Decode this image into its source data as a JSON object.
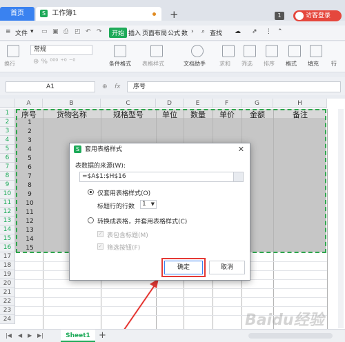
{
  "titlebar": {
    "home_tab": "首页",
    "doc_tab_icon": "S",
    "doc_tab": "工作簿1",
    "new_tab": "+",
    "badge": "1",
    "visitor": "访客登录"
  },
  "menubar": {
    "file": "文件",
    "tabs": [
      "开始",
      "插入",
      "页面布局",
      "公式",
      "数"
    ],
    "search": "查找"
  },
  "ribbon": {
    "format_value": "常规",
    "items": [
      "换行",
      "条件格式",
      "表格样式",
      "文档助手",
      "求和",
      "筛选",
      "排序",
      "格式",
      "填充",
      "行"
    ]
  },
  "formula_bar": {
    "cell_ref": "A1",
    "fx": "fx",
    "content": "序号"
  },
  "grid": {
    "columns": [
      "A",
      "B",
      "C",
      "D",
      "E",
      "F",
      "G",
      "H"
    ],
    "rows": [
      "1",
      "2",
      "3",
      "4",
      "5",
      "6",
      "7",
      "8",
      "9",
      "10",
      "11",
      "12",
      "13",
      "14",
      "15",
      "16",
      "17",
      "18",
      "19",
      "20",
      "21",
      "22",
      "23",
      "24"
    ],
    "headers": [
      "序号",
      "货物名称",
      "规格型号",
      "单位",
      "数量",
      "单价",
      "金额",
      "备注"
    ],
    "numbers": [
      "1",
      "2",
      "3",
      "4",
      "5",
      "6",
      "7",
      "8",
      "9",
      "10",
      "11",
      "12",
      "13",
      "14",
      "15"
    ]
  },
  "dialog": {
    "title": "套用表格样式",
    "source_label": "表数据的来源(W):",
    "source_value": "=$A$1:$H$16",
    "option1": "仅套用表格样式(O)",
    "header_rows_label": "标题行的行数",
    "header_rows_value": "1",
    "option2": "转换成表格，并套用表格样式(C)",
    "check1": "表包含标题(M)",
    "check2": "筛选按钮(F)",
    "ok": "确定",
    "cancel": "取消"
  },
  "bottombar": {
    "sheet": "Sheet1",
    "add": "+"
  },
  "watermark": "Baidu经验",
  "colors": {
    "accent": "#1eaa59",
    "highlight": "#e53935",
    "home_tab": "#3a82f0"
  }
}
